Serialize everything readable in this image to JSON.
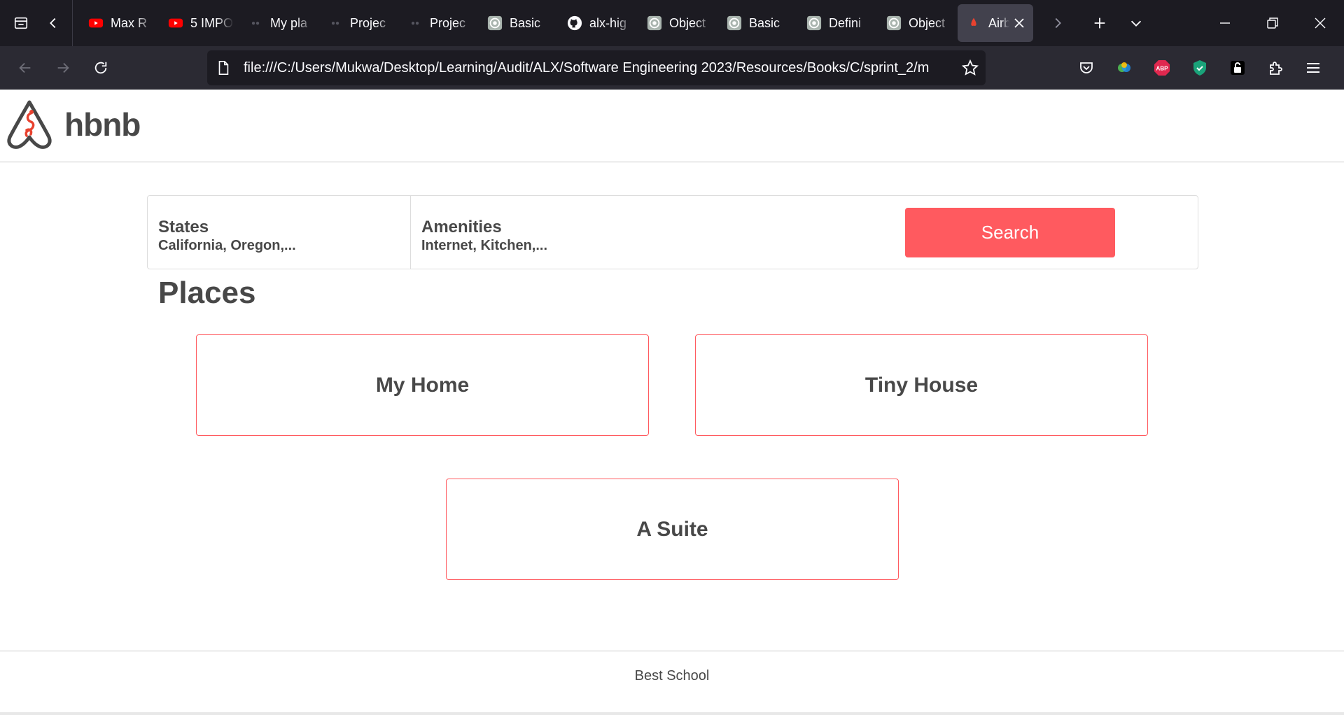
{
  "browser": {
    "tabs": [
      {
        "title": "Max R",
        "icon": "youtube-icon"
      },
      {
        "title": "5 IMPO",
        "icon": "youtube-icon"
      },
      {
        "title": "My pla",
        "icon": "page-icon"
      },
      {
        "title": "Projec",
        "icon": "page-icon"
      },
      {
        "title": "Projec",
        "icon": "page-icon"
      },
      {
        "title": "Basic",
        "icon": "target-icon"
      },
      {
        "title": "alx-hig",
        "icon": "github-icon"
      },
      {
        "title": "Object",
        "icon": "target-icon"
      },
      {
        "title": "Basic",
        "icon": "target-icon"
      },
      {
        "title": "Defini",
        "icon": "target-icon"
      },
      {
        "title": "Object",
        "icon": "target-icon"
      },
      {
        "title": "Airb",
        "icon": "airbnb-icon",
        "active": true
      }
    ],
    "url": "file:///C:/Users/Mukwa/Desktop/Learning/Audit/ALX/Software Engineering 2023/Resources/Books/C/sprint_2/m",
    "colors": {
      "tabbar": "#1c1b22",
      "toolbar": "#2b2a33",
      "urlbar": "#1c1b22",
      "active_tab": "#42414d"
    }
  },
  "site": {
    "logo_text": "hbnb",
    "filters": {
      "states": {
        "title": "States",
        "subtitle": "California, Oregon,..."
      },
      "amenities": {
        "title": "Amenities",
        "subtitle": "Internet, Kitchen,..."
      },
      "search_label": "Search"
    },
    "places_title": "Places",
    "places": [
      {
        "name": "My Home"
      },
      {
        "name": "Tiny House"
      },
      {
        "name": "A Suite"
      }
    ],
    "footer_text": "Best School",
    "colors": {
      "accent": "#ff5a5f",
      "text": "#484848",
      "border": "#dddddd"
    }
  }
}
